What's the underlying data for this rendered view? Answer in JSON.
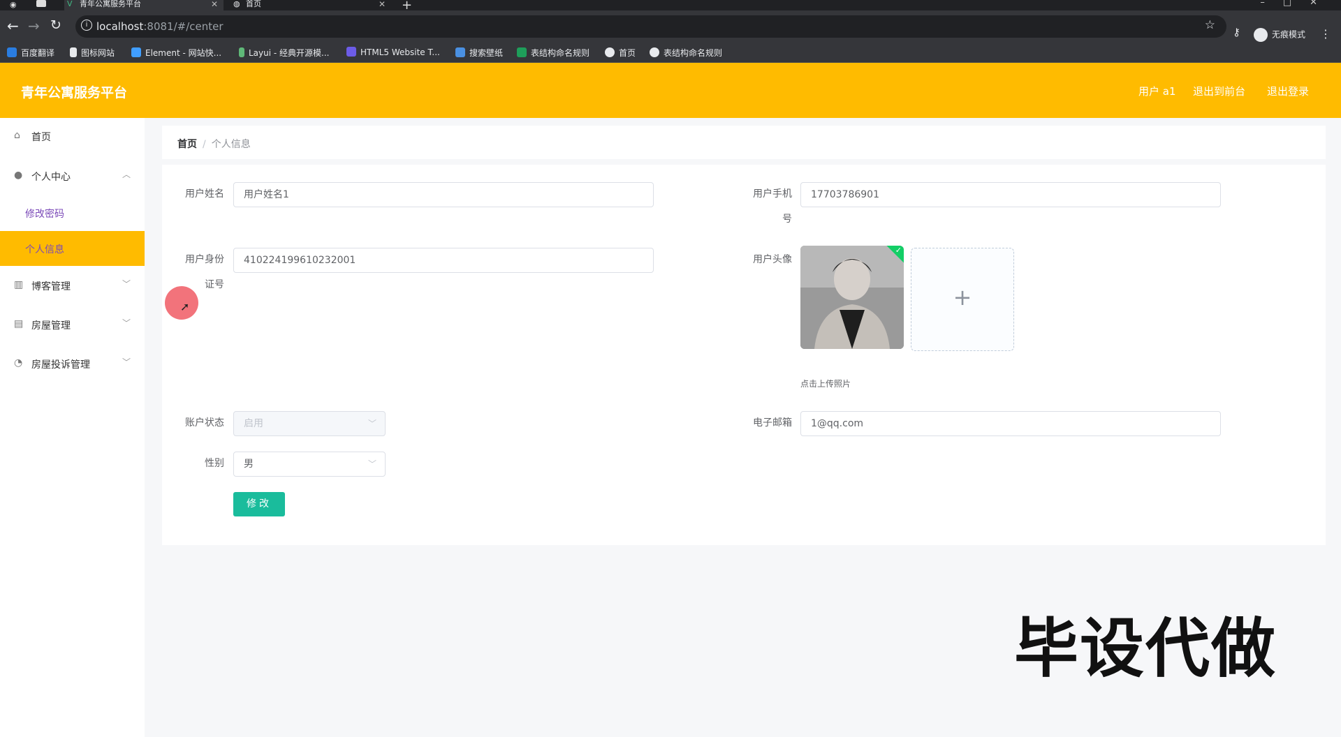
{
  "browser": {
    "tabs": [
      {
        "title": "青年公寓服务平台",
        "active": true
      },
      {
        "title": "首页",
        "active": false
      }
    ],
    "url_host": "localhost",
    "url_rest": ":8081/#/center",
    "profile_label": "无痕模式",
    "bookmarks": [
      "百度翻译",
      "图标网站",
      "Element - 网站快...",
      "Layui - 经典开源模...",
      "HTML5 Website T...",
      "搜索壁纸",
      "表结构命名规则",
      "首页",
      "表结构命名规则"
    ]
  },
  "header": {
    "title": "青年公寓服务平台",
    "user": "用户 a1",
    "back_to_front": "退出到前台",
    "logout": "退出登录",
    "brand_color": "#ffbb00"
  },
  "sidebar": {
    "home": "首页",
    "personal_center": "个人中心",
    "change_password": "修改密码",
    "personal_info": "个人信息",
    "blog_mgmt": "博客管理",
    "house_mgmt": "房屋管理",
    "complaint_mgmt": "房屋投诉管理"
  },
  "breadcrumb": {
    "home": "首页",
    "separator": "/",
    "current": "个人信息"
  },
  "form": {
    "name_label": "用户姓名",
    "name_value": "用户姓名1",
    "phone_label_1": "用户手机",
    "phone_label_2": "号",
    "phone_value": "17703786901",
    "idcard_label_1": "用户身份",
    "idcard_label_2": "证号",
    "idcard_value": "410224199610232001",
    "avatar_label": "用户头像",
    "upload_plus": "+",
    "upload_tip": "点击上传照片",
    "status_label": "账户状态",
    "status_value": "启用",
    "email_label": "电子邮箱",
    "email_value": "1@qq.com",
    "gender_label": "性别",
    "gender_value": "男",
    "submit_label": "修改"
  },
  "overlay": {
    "watermark": "毕设代做"
  }
}
